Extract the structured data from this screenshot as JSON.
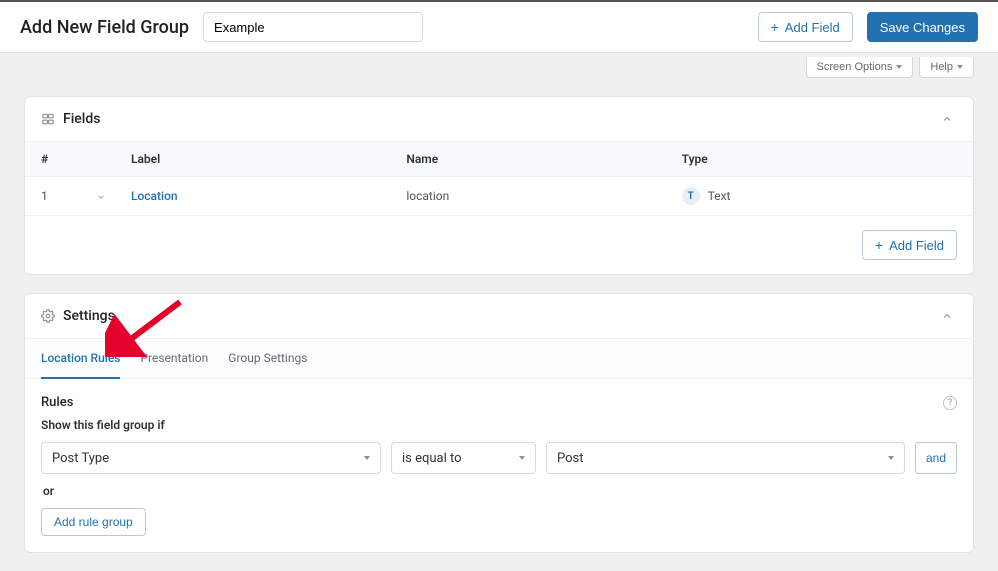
{
  "header": {
    "page_title": "Add New Field Group",
    "title_input_value": "Example",
    "add_field_label": "Add Field",
    "save_changes_label": "Save Changes"
  },
  "screen_options": {
    "screen_options_label": "Screen Options",
    "help_label": "Help"
  },
  "fields_panel": {
    "title": "Fields",
    "columns": {
      "num": "#",
      "label": "Label",
      "name": "Name",
      "type": "Type"
    },
    "rows": [
      {
        "num": "1",
        "label": "Location",
        "name": "location",
        "type_badge": "T",
        "type_name": "Text"
      }
    ],
    "add_field_label": "Add Field"
  },
  "settings_panel": {
    "title": "Settings",
    "tabs": {
      "location_rules": "Location Rules",
      "presentation": "Presentation",
      "group_settings": "Group Settings"
    },
    "rules": {
      "title": "Rules",
      "subtitle": "Show this field group if",
      "param": "Post Type",
      "operator": "is equal to",
      "value": "Post",
      "and_label": "and",
      "or_label": "or",
      "add_rule_group_label": "Add rule group"
    }
  }
}
